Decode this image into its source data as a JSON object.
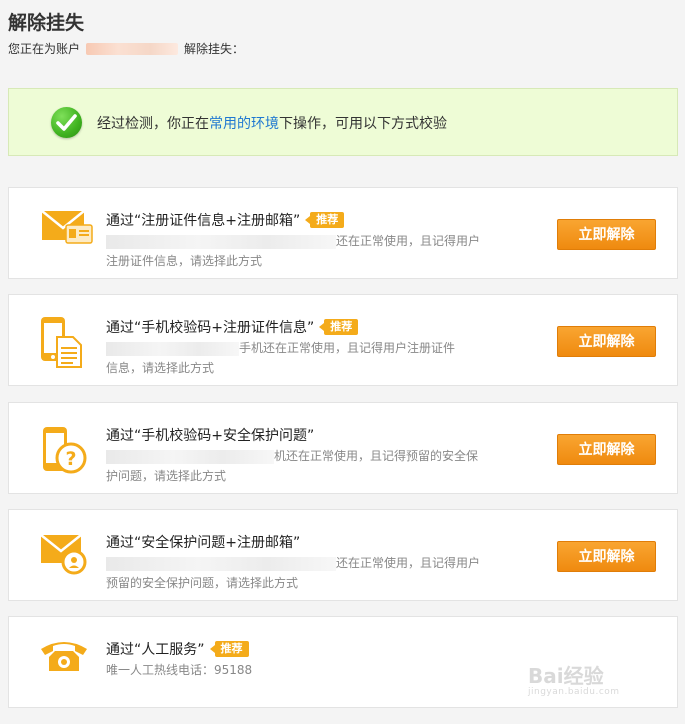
{
  "header": {
    "title": "解除挂失",
    "subtitle_prefix": "您正在为账户",
    "subtitle_suffix": "解除挂失："
  },
  "notice": {
    "text_before": "经过检测，你正在",
    "link": "常用的环境",
    "text_after": "下操作，可用以下方式校验"
  },
  "options": [
    {
      "title": "通过“注册证件信息+注册邮箱”",
      "badge": "推荐",
      "desc_line1": "还在正常使用，且记得用户",
      "desc_line2": "注册证件信息，请选择此方式",
      "button": "立即解除",
      "icon": "envelope-id-card-icon"
    },
    {
      "title": "通过“手机校验码+注册证件信息”",
      "badge": "推荐",
      "desc_line1": "手机还在正常使用，且记得用户注册证件",
      "desc_line2": "信息，请选择此方式",
      "button": "立即解除",
      "icon": "phone-document-icon"
    },
    {
      "title": "通过“手机校验码+安全保护问题”",
      "desc_line1": "机还在正常使用，且记得预留的安全保",
      "desc_line2": "护问题，请选择此方式",
      "button": "立即解除",
      "icon": "phone-question-icon"
    },
    {
      "title": "通过“安全保护问题+注册邮箱”",
      "desc_line1": "还在正常使用，且记得用户",
      "desc_line2": "预留的安全保护问题，请选择此方式",
      "button": "立即解除",
      "icon": "envelope-lock-icon"
    },
    {
      "title": "通过“人工服务”",
      "badge": "推荐",
      "desc_line1": "唯一人工热线电话：95188",
      "icon": "telephone-icon"
    }
  ],
  "watermark": {
    "brand": "Bai经验",
    "url": "jingyan.baidu.com"
  },
  "colors": {
    "accent_orange": "#f4ab1a",
    "button_orange": "#ef8a0f",
    "link_blue": "#1f78d1",
    "notice_bg": "#eefcd6"
  }
}
